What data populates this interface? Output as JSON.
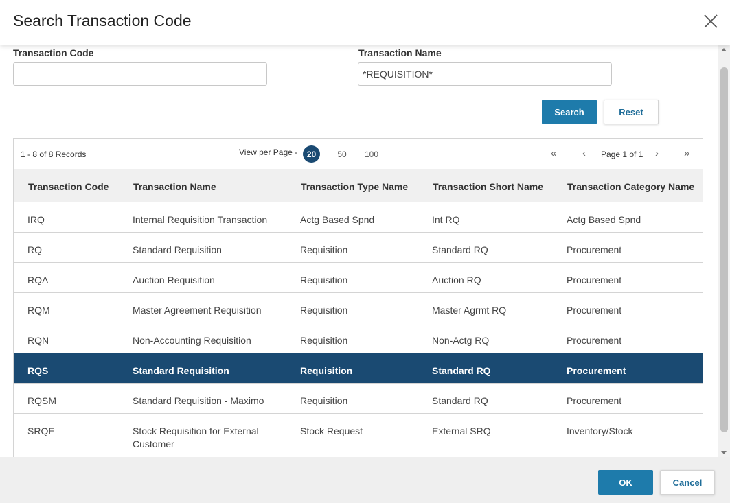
{
  "dialog": {
    "title": "Search Transaction Code"
  },
  "form": {
    "code_label": "Transaction Code",
    "code_value": "",
    "name_label": "Transaction Name",
    "name_value": "*REQUISITION*"
  },
  "actions": {
    "search": "Search",
    "reset": "Reset"
  },
  "pager": {
    "records": "1 - 8 of 8 Records",
    "view_per_page": "View per Page -",
    "options": [
      "20",
      "50",
      "100"
    ],
    "selected": "20",
    "page_text": "Page 1 of 1"
  },
  "table": {
    "columns": [
      "Transaction Code",
      "Transaction Name",
      "Transaction Type Name",
      "Transaction Short Name",
      "Transaction Category Name"
    ],
    "rows": [
      [
        "IRQ",
        "Internal Requisition Transaction",
        "Actg Based Spnd",
        "Int RQ",
        "Actg Based Spnd"
      ],
      [
        "RQ",
        "Standard Requisition",
        "Requisition",
        "Standard RQ",
        "Procurement"
      ],
      [
        "RQA",
        "Auction Requisition",
        "Requisition",
        "Auction RQ",
        "Procurement"
      ],
      [
        "RQM",
        "Master Agreement Requisition",
        "Requisition",
        "Master Agrmt RQ",
        "Procurement"
      ],
      [
        "RQN",
        "Non-Accounting Requisition",
        "Requisition",
        "Non-Actg RQ",
        "Procurement"
      ],
      [
        "RQS",
        "Standard Requisition",
        "Requisition",
        "Standard RQ",
        "Procurement"
      ],
      [
        "RQSM",
        "Standard Requisition - Maximo",
        "Requisition",
        "Standard RQ",
        "Procurement"
      ],
      [
        "SRQE",
        "Stock Requisition for External Customer",
        "Stock Request",
        "External SRQ",
        "Inventory/Stock"
      ]
    ],
    "selected_row": 5
  },
  "footer": {
    "ok": "OK",
    "cancel": "Cancel"
  },
  "colors": {
    "primary": "#1e7bab",
    "selected_row": "#1a4a72",
    "header_bg": "#f0f0f0",
    "footer_bg": "#efefef"
  },
  "icons": [
    "close-icon",
    "first-page-icon",
    "prev-page-icon",
    "next-page-icon",
    "last-page-icon"
  ]
}
